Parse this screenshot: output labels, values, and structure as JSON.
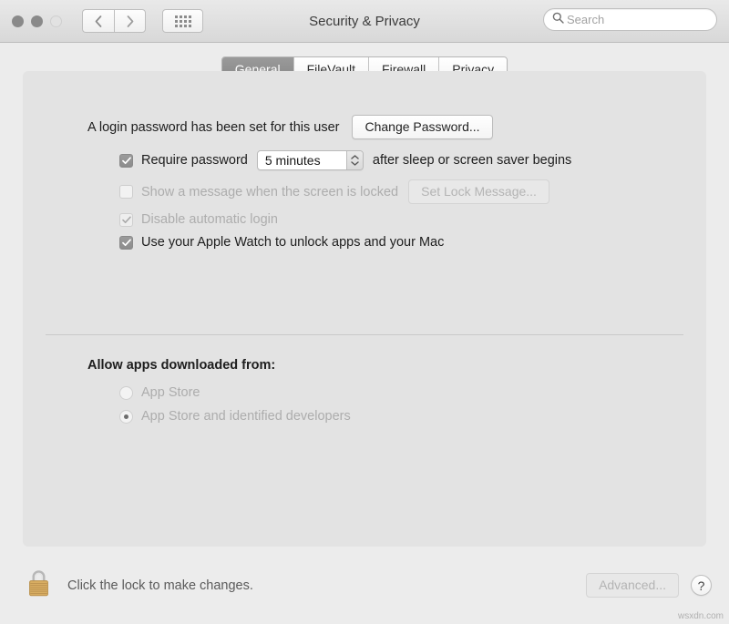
{
  "window": {
    "title": "Security & Privacy",
    "traffic_lights": [
      "close",
      "minimize",
      "zoom"
    ]
  },
  "toolbar": {
    "back_icon": "chevron-left-icon",
    "forward_icon": "chevron-right-icon",
    "grid_icon": "show-all-grid-icon",
    "search": {
      "placeholder": "Search",
      "value": "",
      "icon": "search-icon"
    }
  },
  "tabs": [
    {
      "label": "General",
      "selected": true
    },
    {
      "label": "FileVault",
      "selected": false
    },
    {
      "label": "Firewall",
      "selected": false
    },
    {
      "label": "Privacy",
      "selected": false
    }
  ],
  "general": {
    "password_status": "A login password has been set for this user",
    "change_password_button": "Change Password...",
    "require_password": {
      "label": "Require password",
      "checked": true,
      "interval": "5 minutes",
      "suffix": "after sleep or screen saver begins"
    },
    "show_message": {
      "label": "Show a message when the screen is locked",
      "checked": false,
      "disabled": true,
      "button": "Set Lock Message..."
    },
    "disable_auto_login": {
      "label": "Disable automatic login",
      "checked": true,
      "disabled": true
    },
    "apple_watch": {
      "label": "Use your Apple Watch to unlock apps and your Mac",
      "checked": true,
      "disabled": false
    },
    "allow_apps": {
      "title": "Allow apps downloaded from:",
      "options": [
        {
          "label": "App Store",
          "selected": false
        },
        {
          "label": "App Store and identified developers",
          "selected": true
        }
      ]
    }
  },
  "footer": {
    "lock_icon": "closed-padlock-icon",
    "lock_note": "Click the lock to make changes.",
    "advanced_button": "Advanced...",
    "help_button": "?"
  },
  "watermark": "wsxdn.com",
  "colors": {
    "window_bg": "#ececec",
    "panel_bg": "#e3e3e3",
    "selected_tab": "#8d8d8d",
    "lock_body": "#d8ad62",
    "disabled_text": "#adadad"
  }
}
